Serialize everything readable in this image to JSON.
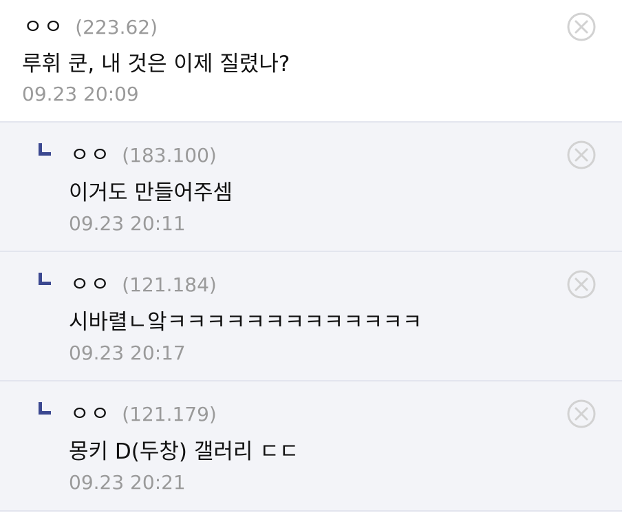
{
  "comments": [
    {
      "nick": "ㅇㅇ",
      "ip": "(223.62)",
      "text": "루휘 쿤, 내 것은 이제 질렸나?",
      "time": "09.23 20:09"
    }
  ],
  "replies": [
    {
      "nick": "ㅇㅇ",
      "ip": "(183.100)",
      "text": "이거도 만들어주셈",
      "time": "09.23 20:11"
    },
    {
      "nick": "ㅇㅇ",
      "ip": "(121.184)",
      "text": "시바렬ㄴ앜ㅋㅋㅋㅋㅋㅋㅋㅋㅋㅋㅋㅋㅋ",
      "time": "09.23 20:17"
    },
    {
      "nick": "ㅇㅇ",
      "ip": "(121.179)",
      "text": "몽키 D(두창) 갤러리 ㄷㄷ",
      "time": "09.23 20:21"
    }
  ],
  "icons": {
    "delete": "close-circle-icon",
    "reply_marker": "reply-arrow-icon"
  },
  "colors": {
    "reply_marker": "#3b4890",
    "reply_bg": "#f3f4f8",
    "divider": "#e3e5ee",
    "meta_text": "#9a9a9a"
  }
}
